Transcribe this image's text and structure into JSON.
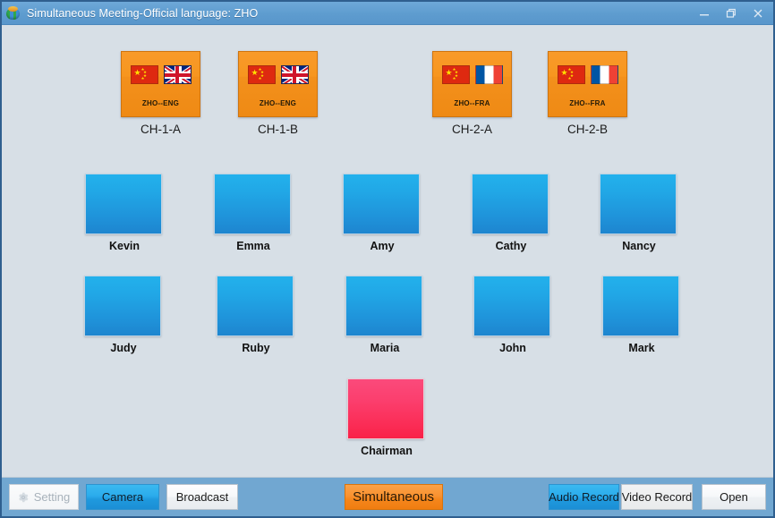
{
  "window": {
    "title": "Simultaneous Meeting-Official language: ZHO",
    "app_icon": "globe-icon",
    "controls": {
      "minimize": "minimize-icon",
      "restore": "restore-icon",
      "close": "close-icon"
    }
  },
  "channels": [
    {
      "label": "CH-1-A",
      "code": "ZHO--ENG",
      "flag_left": "flag-china",
      "flag_right": "flag-uk"
    },
    {
      "label": "CH-1-B",
      "code": "ZHO--ENG",
      "flag_left": "flag-china",
      "flag_right": "flag-uk"
    },
    {
      "label": "CH-2-A",
      "code": "ZHO--FRA",
      "flag_left": "flag-china",
      "flag_right": "flag-france"
    },
    {
      "label": "CH-2-B",
      "code": "ZHO--FRA",
      "flag_left": "flag-china",
      "flag_right": "flag-france"
    }
  ],
  "participants": {
    "row1": [
      {
        "name": "Kevin"
      },
      {
        "name": "Emma"
      },
      {
        "name": "Amy"
      },
      {
        "name": "Cathy"
      },
      {
        "name": "Nancy"
      }
    ],
    "row2": [
      {
        "name": "Judy"
      },
      {
        "name": "Ruby"
      },
      {
        "name": "Maria"
      },
      {
        "name": "John"
      },
      {
        "name": "Mark"
      }
    ],
    "chairman": {
      "name": "Chairman"
    }
  },
  "toolbar": {
    "setting": "Setting",
    "setting_icon": "gear-icon",
    "camera": "Camera",
    "broadcast": "Broadcast",
    "simultaneous": "Simultaneous",
    "audio_record": "Audio Record",
    "video_record": "Video Record",
    "open": "Open"
  },
  "colors": {
    "title_bar": "#5e9ccf",
    "content_bg": "#d7dfe6",
    "toolbar_bg": "#71a7d1",
    "channel_orange": "#f7961f",
    "participant_blue": "#21a7e6",
    "chairman_pink": "#fb3f6e",
    "window_border": "#2f5f8f"
  }
}
